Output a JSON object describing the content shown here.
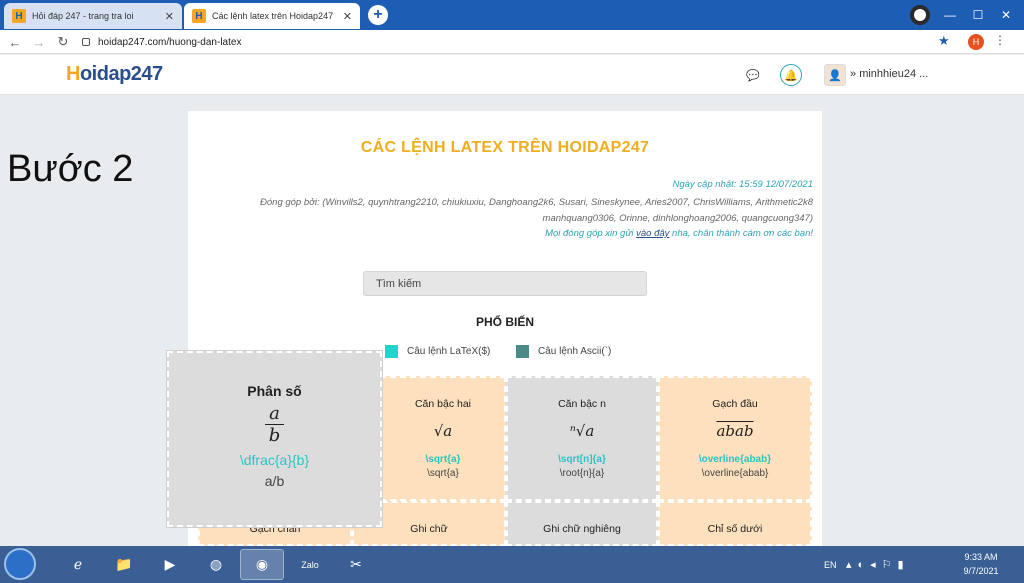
{
  "browser": {
    "tabs": [
      {
        "label": "Hỏi đáp 247 - trang tra loi",
        "active": false
      },
      {
        "label": "Các lệnh latex trên Hoidap247",
        "active": true
      }
    ],
    "url": "hoidap247.com/huong-dan-latex",
    "profile_initial": "H"
  },
  "site": {
    "logo_prefix": "H",
    "logo_text": "oidap247",
    "user_name": "minhhieu24 ..."
  },
  "overlay": {
    "step_text": "Bước 2"
  },
  "page": {
    "title": "CÁC LỆNH LATEX TRÊN HOIDAP247",
    "updated": "Ngày cập nhật: 15:59 12/07/2021",
    "contributors": "Đóng góp bởi: (Winvills2, quynhtrang2210, chiukiuxiu, Danghoang2k6, Susari, Sineskynee, Aries2007, ChrisWilliams, Arithmetic2k8 manhquang0306, Orinne, dinhlonghoang2006, quangcuong347)",
    "invite_prefix": "Mọi đóng góp xin gửi ",
    "invite_link": "vào đây",
    "invite_suffix": " nha, chân thành cám ơn các bạn!",
    "search_placeholder": "Tìm kiếm",
    "section_title": "PHỔ BIẾN",
    "legend": [
      {
        "label": "Câu lệnh LaTeX($)",
        "color": "#22d3cc"
      },
      {
        "label": "Câu lệnh Ascii(`)",
        "color": "#4a8a88"
      }
    ]
  },
  "tiles": {
    "row1": [
      {
        "name": "Căn bậc hai",
        "symbol": "√a",
        "latex": "\\sqrt{a}",
        "ascii": "\\sqrt{a}",
        "bg": "orange"
      },
      {
        "name": "Căn bậc n",
        "symbol": "ⁿ√a",
        "latex": "\\sqrt[n]{a}",
        "ascii": "\\root{n}{a}",
        "bg": "grey"
      },
      {
        "name": "Gạch đầu",
        "symbol": "abab",
        "latex": "\\overline{abab}",
        "ascii": "\\overline{abab}",
        "bg": "orange"
      }
    ],
    "row2": [
      {
        "name": "Gạch chân"
      },
      {
        "name": "Ghi chữ"
      },
      {
        "name": "Ghi chữ nghiêng"
      },
      {
        "name": "Chỉ số dưới"
      }
    ],
    "featured": {
      "name": "Phân số",
      "numerator": "a",
      "denominator": "b",
      "latex": "\\dfrac{a}{b}",
      "ascii": "a/b"
    }
  },
  "taskbar": {
    "lang": "EN",
    "time": "9:33 AM",
    "date": "9/7/2021",
    "zalo_label": "Zalo"
  }
}
